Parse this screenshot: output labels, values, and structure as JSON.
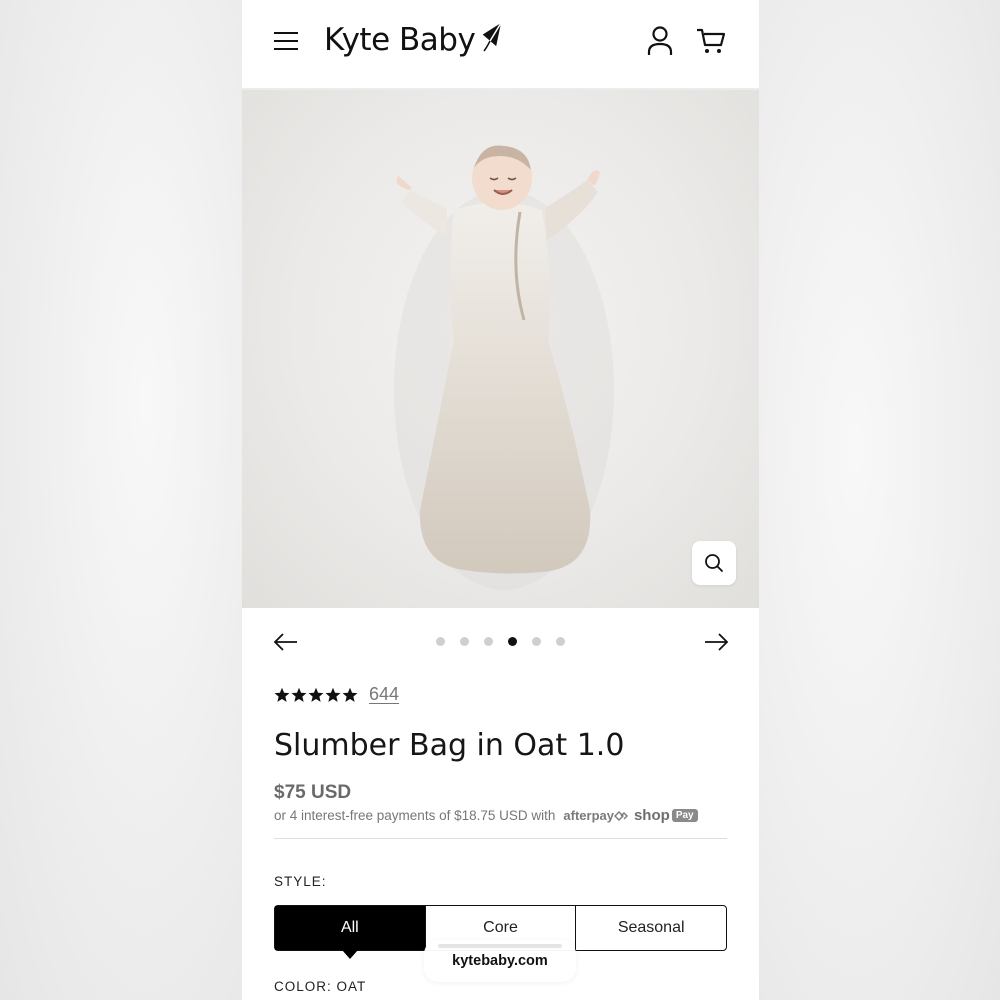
{
  "header": {
    "brand": "Kyte Baby"
  },
  "product": {
    "image_alt": "Baby in oat colored slumber bag",
    "carousel": {
      "total_slides": 6,
      "active_index": 3
    },
    "rating": {
      "stars": 5,
      "review_count": "644"
    },
    "title": "Slumber Bag in Oat 1.0",
    "price": "$75 USD",
    "installments_text": "or 4 interest-free payments of $18.75 USD with",
    "afterpay_label": "afterpay",
    "shop_label": "shop",
    "pay_badge": "Pay",
    "style": {
      "label": "STYLE:",
      "options": [
        "All",
        "Core",
        "Seasonal"
      ],
      "selected": "All"
    },
    "color": {
      "label": "COLOR: OAT"
    }
  },
  "browser": {
    "url": "kytebaby.com"
  },
  "colors": {
    "text_primary": "#161616",
    "text_muted": "#777777",
    "selected_bg": "#000000",
    "image_bg": "#ebeae8"
  }
}
